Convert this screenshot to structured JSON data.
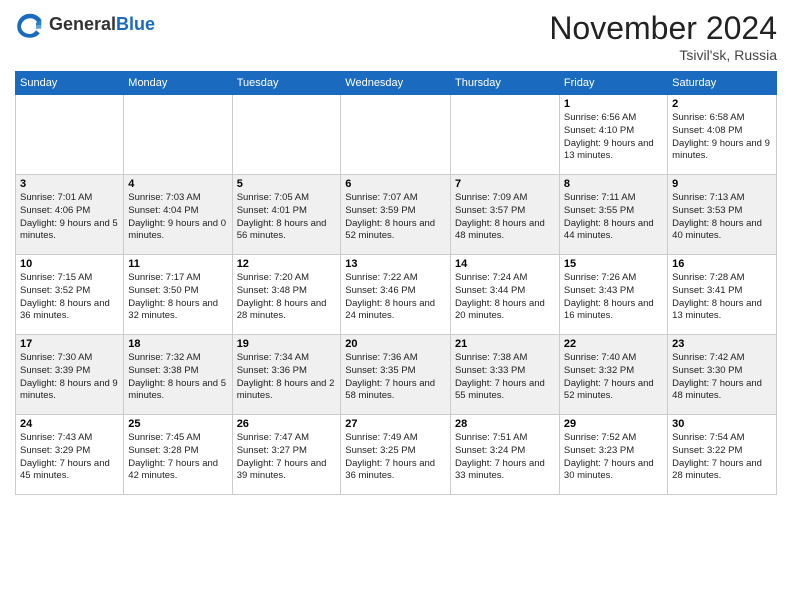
{
  "header": {
    "logo_general": "General",
    "logo_blue": "Blue",
    "month_title": "November 2024",
    "subtitle": "Tsivil'sk, Russia"
  },
  "weekdays": [
    "Sunday",
    "Monday",
    "Tuesday",
    "Wednesday",
    "Thursday",
    "Friday",
    "Saturday"
  ],
  "weeks": [
    {
      "row_class": "row-odd",
      "days": [
        {
          "num": "",
          "info": ""
        },
        {
          "num": "",
          "info": ""
        },
        {
          "num": "",
          "info": ""
        },
        {
          "num": "",
          "info": ""
        },
        {
          "num": "",
          "info": ""
        },
        {
          "num": "1",
          "info": "Sunrise: 6:56 AM\nSunset: 4:10 PM\nDaylight: 9 hours and 13 minutes."
        },
        {
          "num": "2",
          "info": "Sunrise: 6:58 AM\nSunset: 4:08 PM\nDaylight: 9 hours and 9 minutes."
        }
      ]
    },
    {
      "row_class": "row-even",
      "days": [
        {
          "num": "3",
          "info": "Sunrise: 7:01 AM\nSunset: 4:06 PM\nDaylight: 9 hours and 5 minutes."
        },
        {
          "num": "4",
          "info": "Sunrise: 7:03 AM\nSunset: 4:04 PM\nDaylight: 9 hours and 0 minutes."
        },
        {
          "num": "5",
          "info": "Sunrise: 7:05 AM\nSunset: 4:01 PM\nDaylight: 8 hours and 56 minutes."
        },
        {
          "num": "6",
          "info": "Sunrise: 7:07 AM\nSunset: 3:59 PM\nDaylight: 8 hours and 52 minutes."
        },
        {
          "num": "7",
          "info": "Sunrise: 7:09 AM\nSunset: 3:57 PM\nDaylight: 8 hours and 48 minutes."
        },
        {
          "num": "8",
          "info": "Sunrise: 7:11 AM\nSunset: 3:55 PM\nDaylight: 8 hours and 44 minutes."
        },
        {
          "num": "9",
          "info": "Sunrise: 7:13 AM\nSunset: 3:53 PM\nDaylight: 8 hours and 40 minutes."
        }
      ]
    },
    {
      "row_class": "row-odd",
      "days": [
        {
          "num": "10",
          "info": "Sunrise: 7:15 AM\nSunset: 3:52 PM\nDaylight: 8 hours and 36 minutes."
        },
        {
          "num": "11",
          "info": "Sunrise: 7:17 AM\nSunset: 3:50 PM\nDaylight: 8 hours and 32 minutes."
        },
        {
          "num": "12",
          "info": "Sunrise: 7:20 AM\nSunset: 3:48 PM\nDaylight: 8 hours and 28 minutes."
        },
        {
          "num": "13",
          "info": "Sunrise: 7:22 AM\nSunset: 3:46 PM\nDaylight: 8 hours and 24 minutes."
        },
        {
          "num": "14",
          "info": "Sunrise: 7:24 AM\nSunset: 3:44 PM\nDaylight: 8 hours and 20 minutes."
        },
        {
          "num": "15",
          "info": "Sunrise: 7:26 AM\nSunset: 3:43 PM\nDaylight: 8 hours and 16 minutes."
        },
        {
          "num": "16",
          "info": "Sunrise: 7:28 AM\nSunset: 3:41 PM\nDaylight: 8 hours and 13 minutes."
        }
      ]
    },
    {
      "row_class": "row-even",
      "days": [
        {
          "num": "17",
          "info": "Sunrise: 7:30 AM\nSunset: 3:39 PM\nDaylight: 8 hours and 9 minutes."
        },
        {
          "num": "18",
          "info": "Sunrise: 7:32 AM\nSunset: 3:38 PM\nDaylight: 8 hours and 5 minutes."
        },
        {
          "num": "19",
          "info": "Sunrise: 7:34 AM\nSunset: 3:36 PM\nDaylight: 8 hours and 2 minutes."
        },
        {
          "num": "20",
          "info": "Sunrise: 7:36 AM\nSunset: 3:35 PM\nDaylight: 7 hours and 58 minutes."
        },
        {
          "num": "21",
          "info": "Sunrise: 7:38 AM\nSunset: 3:33 PM\nDaylight: 7 hours and 55 minutes."
        },
        {
          "num": "22",
          "info": "Sunrise: 7:40 AM\nSunset: 3:32 PM\nDaylight: 7 hours and 52 minutes."
        },
        {
          "num": "23",
          "info": "Sunrise: 7:42 AM\nSunset: 3:30 PM\nDaylight: 7 hours and 48 minutes."
        }
      ]
    },
    {
      "row_class": "row-odd",
      "days": [
        {
          "num": "24",
          "info": "Sunrise: 7:43 AM\nSunset: 3:29 PM\nDaylight: 7 hours and 45 minutes."
        },
        {
          "num": "25",
          "info": "Sunrise: 7:45 AM\nSunset: 3:28 PM\nDaylight: 7 hours and 42 minutes."
        },
        {
          "num": "26",
          "info": "Sunrise: 7:47 AM\nSunset: 3:27 PM\nDaylight: 7 hours and 39 minutes."
        },
        {
          "num": "27",
          "info": "Sunrise: 7:49 AM\nSunset: 3:25 PM\nDaylight: 7 hours and 36 minutes."
        },
        {
          "num": "28",
          "info": "Sunrise: 7:51 AM\nSunset: 3:24 PM\nDaylight: 7 hours and 33 minutes."
        },
        {
          "num": "29",
          "info": "Sunrise: 7:52 AM\nSunset: 3:23 PM\nDaylight: 7 hours and 30 minutes."
        },
        {
          "num": "30",
          "info": "Sunrise: 7:54 AM\nSunset: 3:22 PM\nDaylight: 7 hours and 28 minutes."
        }
      ]
    }
  ]
}
